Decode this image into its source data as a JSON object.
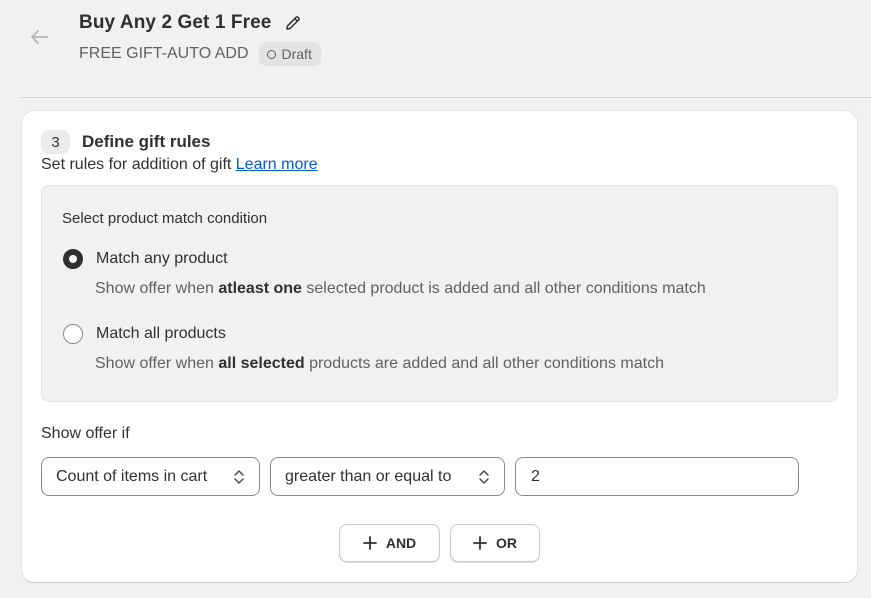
{
  "header": {
    "title": "Buy Any 2 Get 1 Free",
    "subtitle": "FREE GIFT-AUTO ADD",
    "status": "Draft",
    "icons": {
      "back": "arrow-left-icon",
      "edit": "pencil-icon",
      "status": "circle-outline-icon"
    }
  },
  "step": {
    "number": "3",
    "title": "Define gift rules",
    "description": "Set rules for addition of gift",
    "learn_more": "Learn more"
  },
  "match_condition": {
    "heading": "Select product match condition",
    "options": [
      {
        "label": "Match any product",
        "checked": true,
        "help_prefix": "Show offer when",
        "help_bold": "atleast one",
        "help_suffix": "selected product is added and all other conditions match"
      },
      {
        "label": "Match all products",
        "checked": false,
        "help_prefix": "Show offer when",
        "help_bold": "all selected",
        "help_suffix": "products are added and all other conditions match"
      }
    ]
  },
  "rule": {
    "label": "Show offer if",
    "field": "Count of items in cart",
    "operator": "greater than or equal to",
    "value": "2"
  },
  "logic_buttons": {
    "and": "AND",
    "or": "OR"
  },
  "colors": {
    "link": "#005bd3",
    "text": "#303030",
    "muted": "#616161",
    "background": "#f1f1f1"
  }
}
